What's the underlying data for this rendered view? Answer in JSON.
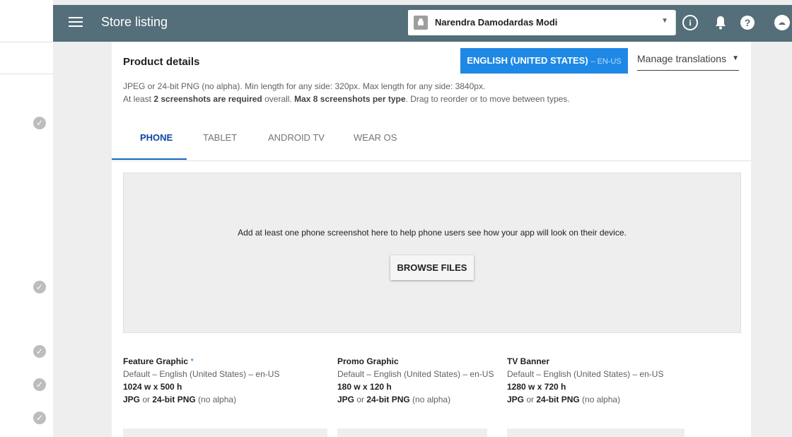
{
  "app_bar": {
    "title": "Store listing",
    "account_name": "Narendra Damodardas Modi"
  },
  "icons": {
    "menu": "menu-icon",
    "app": "android-icon",
    "caret": "dropdown-arrow-icon",
    "info": "info-icon",
    "bell": "notifications-icon",
    "help": "help-icon",
    "profile": "profile-icon",
    "check": "check-circle-icon"
  },
  "product_details": {
    "title": "Product details",
    "language_button": "ENGLISH (UNITED STATES)",
    "language_code": "– EN-US",
    "manage_translations": "Manage translations",
    "requirement_line1": "JPEG or 24-bit PNG (no alpha). Min length for any side: 320px. Max length for any side: 3840px.",
    "requirement_line2_a": "At least ",
    "requirement_line2_b": "2 screenshots are required",
    "requirement_line2_c": " overall. ",
    "requirement_line2_d": "Max 8 screenshots per type",
    "requirement_line2_e": ". Drag to reorder or to move between types."
  },
  "tabs": [
    "PHONE",
    "TABLET",
    "ANDROID TV",
    "WEAR OS"
  ],
  "dropzone": {
    "message": "Add at least one phone screenshot here to help phone users see how your app will look on their device.",
    "browse_button": "BROWSE FILES"
  },
  "graphics": [
    {
      "title": "Feature Graphic",
      "required": "*",
      "language": "Default – English (United States) – en-US",
      "size": "1024 w x 500 h",
      "fmt_a": "JPG",
      "fmt_b": " or ",
      "fmt_c": "24-bit PNG",
      "fmt_d": " (no alpha)"
    },
    {
      "title": "Promo Graphic",
      "required": "",
      "language": "Default – English (United States) – en-US",
      "size": "180 w x 120 h",
      "fmt_a": "JPG",
      "fmt_b": " or ",
      "fmt_c": "24-bit PNG",
      "fmt_d": " (no alpha)"
    },
    {
      "title": "TV Banner",
      "required": "",
      "language": "Default – English (United States) – en-US",
      "size": "1280 w x 720 h",
      "fmt_a": "JPG",
      "fmt_b": " or ",
      "fmt_c": "24-bit PNG",
      "fmt_d": " (no alpha)"
    }
  ],
  "colors": {
    "app_bar": "#546e7a",
    "accent": "#1e88e5",
    "active_tab": "#0d47a1"
  }
}
